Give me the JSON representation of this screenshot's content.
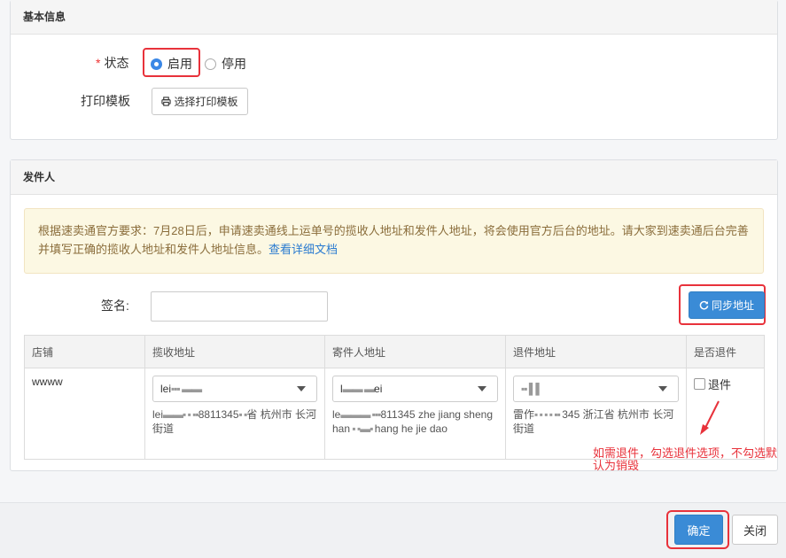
{
  "basic": {
    "header": "基本信息",
    "status_label": "状态",
    "status_star": "*",
    "status_enable": "启用",
    "status_disable": "停用",
    "status_selected": "启用",
    "print_label": "打印模板",
    "print_button": "选择打印模板",
    "print_icon": "printer-icon"
  },
  "sender": {
    "header": "发件人",
    "notice_text": "根据速卖通官方要求：7月28日后，申请速卖通线上运单号的揽收人地址和发件人地址，将会使用官方后台的地址。请大家到速卖通后台完善并填写正确的揽收人地址和发件人地址信息。",
    "notice_link": "查看详细文档",
    "signature_label": "签名:",
    "signature_value": "",
    "sync_button": "同步地址",
    "sync_icon": "refresh-icon",
    "table": {
      "headers": [
        "店铺",
        "揽收地址",
        "寄件人地址",
        "退件地址",
        "是否退件"
      ],
      "row": {
        "store": "wwww",
        "pickup_select": "lei",
        "pickup_text_a": "lei",
        "pickup_text_b": "8811345",
        "pickup_text_c": "省 杭州市 长河街道",
        "sender_select_a": "l",
        "sender_select_b": "ei",
        "sender_text_a": "le",
        "sender_text_b": "811345 zhe jiang sheng han",
        "sender_text_c": "hang he jie dao",
        "return_select": "",
        "return_text_a": "雷作",
        "return_text_b": "345 浙江省 杭州市 长河街道",
        "return_checkbox_label": "退件",
        "return_checked": false
      }
    },
    "annotation": "如需退件，勾选退件选项，不勾选默认为销毁"
  },
  "footer": {
    "confirm": "确定",
    "close": "关闭"
  },
  "colors": {
    "primary": "#3a8bd6",
    "highlight": "#e8323b",
    "notice_bg": "#fcf8e3",
    "notice_text": "#8a6d3b"
  }
}
